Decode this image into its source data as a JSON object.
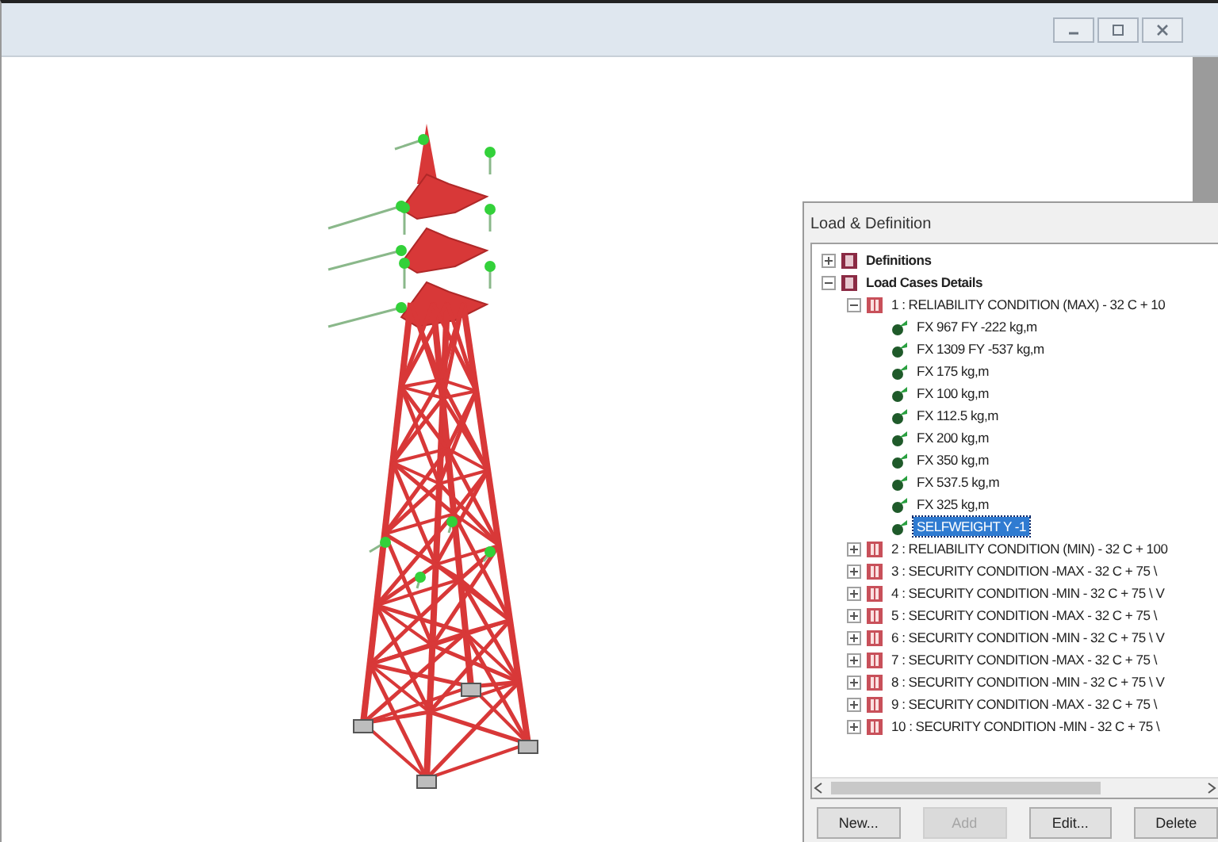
{
  "panel": {
    "title": "Load & Definition",
    "tree": [
      {
        "label": "Definitions",
        "kind": "category",
        "expanded": false,
        "selected": false
      },
      {
        "label": "Load Cases Details",
        "kind": "category",
        "expanded": true,
        "selected": false,
        "children": [
          {
            "label": "1 : RELIABILITY CONDITION (MAX) - 32 C + 10",
            "kind": "case",
            "expanded": true,
            "selected": false,
            "children": [
              {
                "label": "FX 967 FY -222 kg,m",
                "kind": "load",
                "selected": false
              },
              {
                "label": "FX 1309 FY -537 kg,m",
                "kind": "load",
                "selected": false
              },
              {
                "label": "FX 175 kg,m",
                "kind": "load",
                "selected": false
              },
              {
                "label": "FX 100 kg,m",
                "kind": "load",
                "selected": false
              },
              {
                "label": "FX 112.5 kg,m",
                "kind": "load",
                "selected": false
              },
              {
                "label": "FX 200 kg,m",
                "kind": "load",
                "selected": false
              },
              {
                "label": "FX 350 kg,m",
                "kind": "load",
                "selected": false
              },
              {
                "label": "FX 537.5 kg,m",
                "kind": "load",
                "selected": false
              },
              {
                "label": "FX 325 kg,m",
                "kind": "load",
                "selected": false
              },
              {
                "label": "SELFWEIGHT Y -1",
                "kind": "load",
                "selected": true
              }
            ]
          },
          {
            "label": "2 : RELIABILITY CONDITION (MIN) - 32 C + 100",
            "kind": "case",
            "expanded": false,
            "selected": false
          },
          {
            "label": "3 : SECURITY CONDITION -MAX - 32 C + 75 \\",
            "kind": "case",
            "expanded": false,
            "selected": false
          },
          {
            "label": "4 : SECURITY CONDITION -MIN - 32 C + 75 \\ V",
            "kind": "case",
            "expanded": false,
            "selected": false
          },
          {
            "label": "5 : SECURITY CONDITION -MAX - 32 C + 75 \\",
            "kind": "case",
            "expanded": false,
            "selected": false
          },
          {
            "label": "6 : SECURITY CONDITION -MIN - 32 C + 75 \\ V",
            "kind": "case",
            "expanded": false,
            "selected": false
          },
          {
            "label": "7 : SECURITY CONDITION -MAX - 32 C + 75 \\",
            "kind": "case",
            "expanded": false,
            "selected": false
          },
          {
            "label": "8 : SECURITY CONDITION -MIN - 32 C + 75 \\ V",
            "kind": "case",
            "expanded": false,
            "selected": false
          },
          {
            "label": "9 : SECURITY CONDITION -MAX - 32 C + 75 \\",
            "kind": "case",
            "expanded": false,
            "selected": false
          },
          {
            "label": "10 : SECURITY CONDITION -MIN - 32 C + 75 \\",
            "kind": "case",
            "expanded": false,
            "selected": false
          }
        ]
      }
    ],
    "buttons": [
      {
        "label": "New...",
        "disabled": false
      },
      {
        "label": "Add",
        "disabled": true
      },
      {
        "label": "Edit...",
        "disabled": false
      },
      {
        "label": "Delete",
        "disabled": false
      }
    ]
  }
}
